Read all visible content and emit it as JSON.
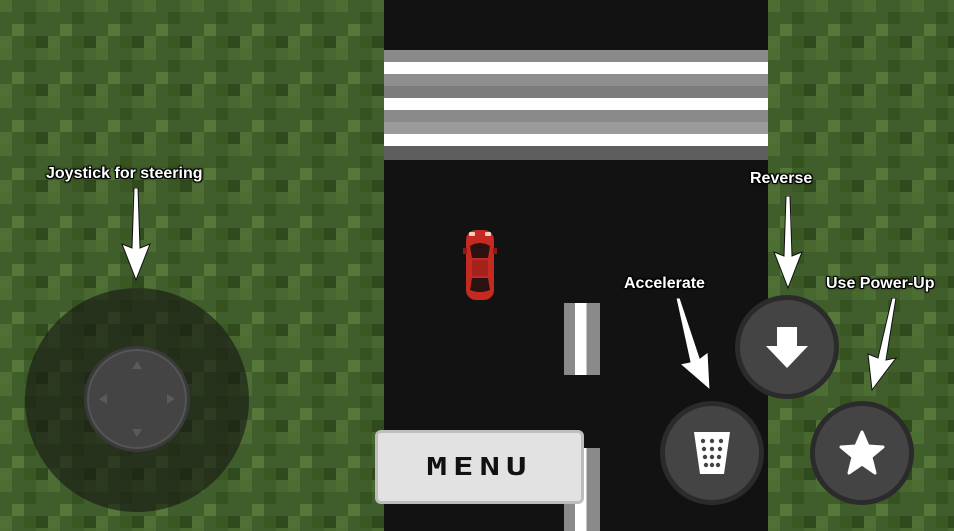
{
  "hud": {
    "joystick_label": "Joystick for steering",
    "reverse_label": "Reverse",
    "accelerate_label": "Accelerate",
    "powerup_label": "Use Power-Up",
    "menu_label": "MENU"
  },
  "icons": {
    "reverse": "down-arrow-icon",
    "accelerate": "pedal-icon",
    "powerup": "star-icon",
    "joystick": "dpad-icon"
  },
  "colors": {
    "grass": "#3f5e2a",
    "road": "#121212",
    "car": "#c42a22",
    "button": "#444444",
    "menu_bg": "#e2e2e2"
  }
}
